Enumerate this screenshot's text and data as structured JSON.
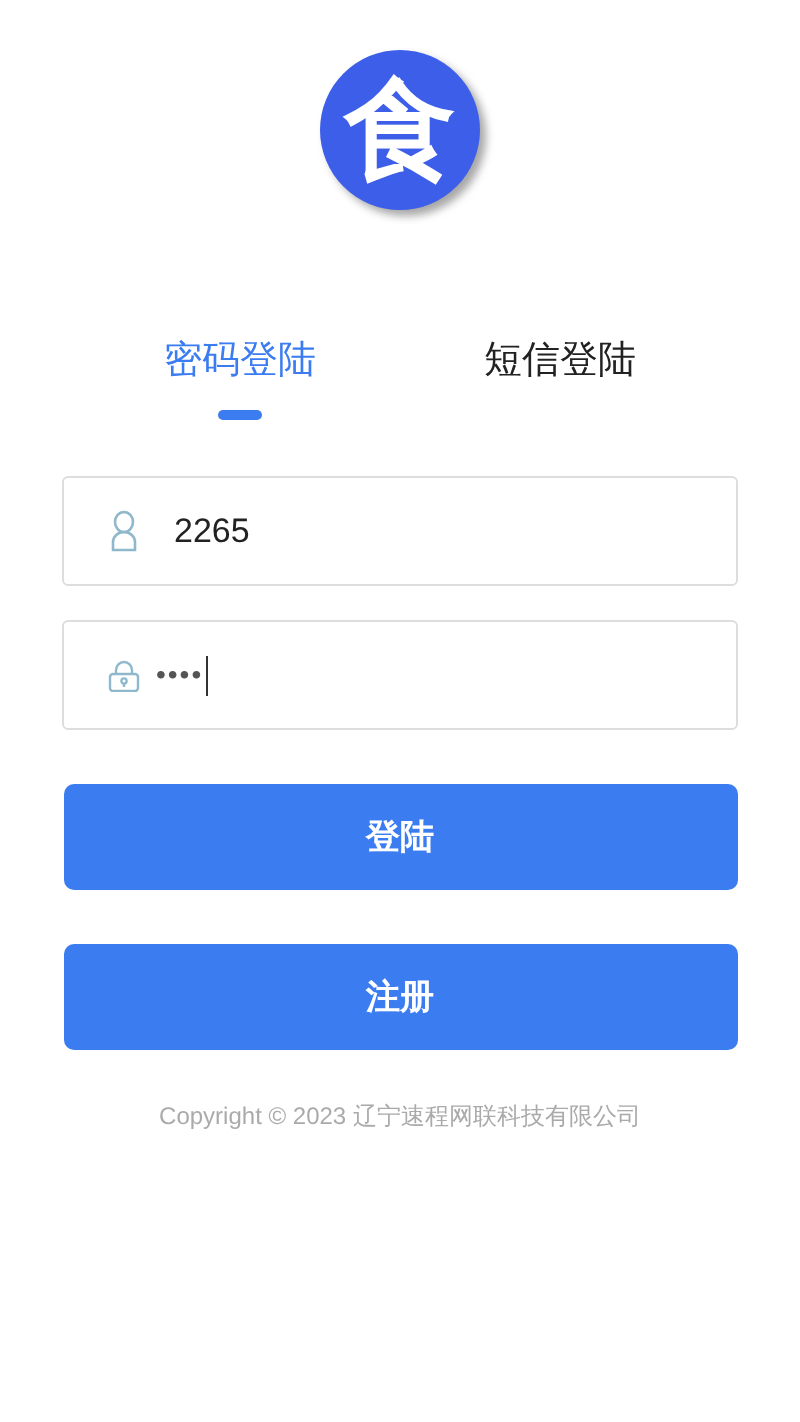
{
  "logo": {
    "text": "食"
  },
  "tabs": [
    {
      "label": "密码登陆",
      "selected": true
    },
    {
      "label": "短信登陆",
      "selected": false
    }
  ],
  "fields": [
    {
      "kind": "user",
      "value": "2265",
      "focused": false
    },
    {
      "kind": "password",
      "value": "••••",
      "focused": true
    }
  ],
  "buttons": [
    "登陆",
    "注册"
  ],
  "footer": "Copyright © 2023 辽宁速程网联科技有限公司"
}
